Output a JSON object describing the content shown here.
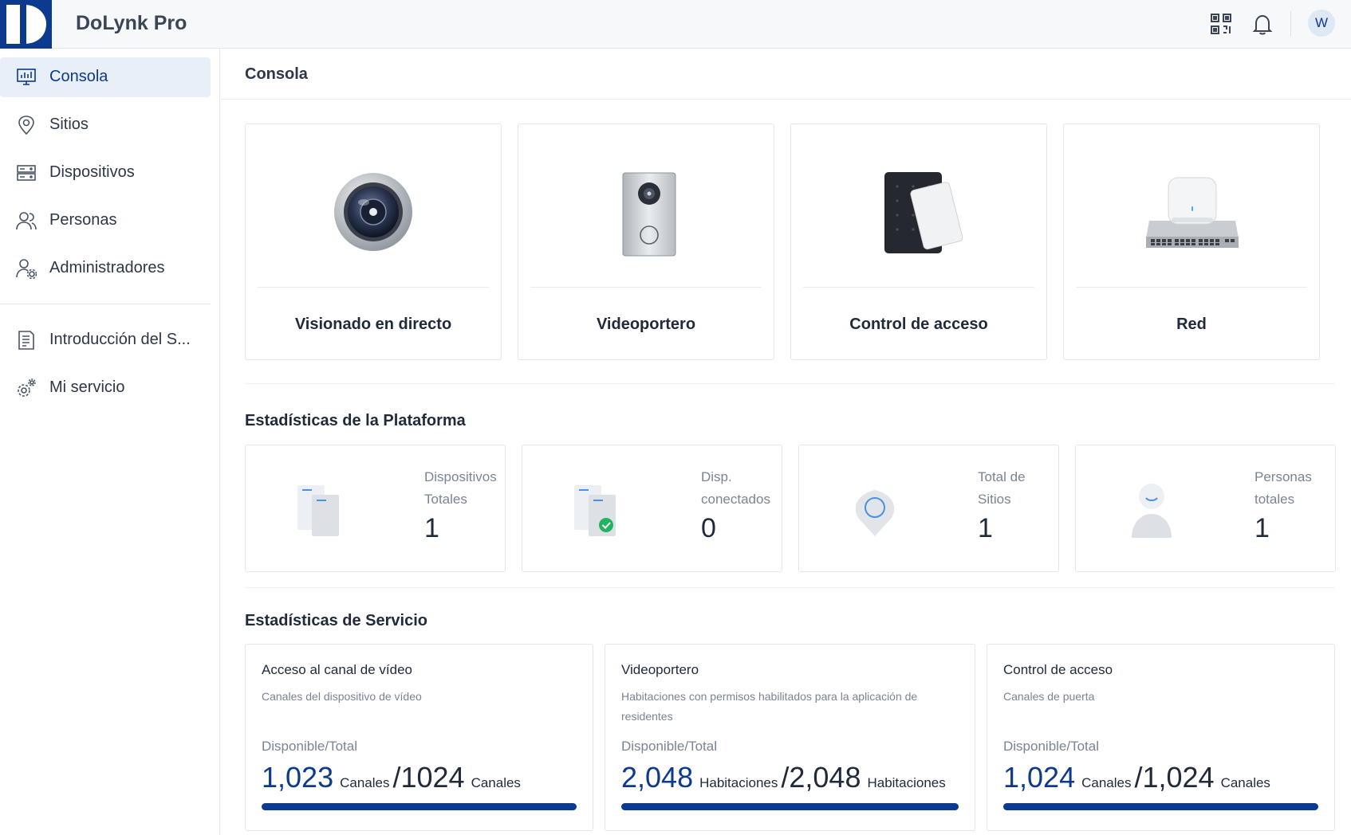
{
  "app": {
    "title": "DoLynk Pro",
    "user_initial": "W"
  },
  "header": {
    "icons": [
      "qr-code-icon",
      "bell-icon"
    ]
  },
  "sidebar": {
    "items": [
      {
        "label": "Consola",
        "icon": "monitor-chart-icon",
        "active": true
      },
      {
        "label": "Sitios",
        "icon": "location-pin-icon"
      },
      {
        "label": "Dispositivos",
        "icon": "server-rack-icon"
      },
      {
        "label": "Personas",
        "icon": "users-icon"
      },
      {
        "label": "Administradores",
        "icon": "user-gear-icon"
      },
      {
        "label": "Introducción del S...",
        "icon": "document-icon"
      },
      {
        "label": "Mi servicio",
        "icon": "gears-icon"
      }
    ]
  },
  "main": {
    "page_title": "Consola",
    "features": [
      {
        "label": "Visionado en directo",
        "icon": "camera-lens-icon"
      },
      {
        "label": "Videoportero",
        "icon": "door-station-icon"
      },
      {
        "label": "Control de acceso",
        "icon": "card-reader-icon"
      },
      {
        "label": "Red",
        "icon": "network-switch-icon"
      }
    ],
    "platform_stats": {
      "title": "Estadísticas de la Plataforma",
      "items": [
        {
          "label": "Dispositivos Totales",
          "value": "1",
          "icon": "devices-icon"
        },
        {
          "label": "Disp. conectados",
          "value": "0",
          "icon": "devices-connected-icon"
        },
        {
          "label": "Total de Sitios",
          "value": "1",
          "icon": "site-pin-icon"
        },
        {
          "label": "Personas totales",
          "value": "1",
          "icon": "person-icon"
        }
      ]
    },
    "service_stats": {
      "title": "Estadísticas de Servicio",
      "items": [
        {
          "title": "Acceso al canal de vídeo",
          "desc": "Canales del dispositivo de vídeo",
          "avail_label": "Disponible/Total",
          "available": "1,023",
          "available_unit": "Canales",
          "total": "/1024",
          "total_unit": "Canales",
          "fill": 0.999
        },
        {
          "title": "Videoportero",
          "desc": "Habitaciones con permisos habilitados para la aplicación de residentes",
          "avail_label": "Disponible/Total",
          "available": "2,048",
          "available_unit": "Habitaciones",
          "total": "/2,048",
          "total_unit": "Habitaciones",
          "fill": 1.0
        },
        {
          "title": "Control de acceso",
          "desc": "Canales de puerta",
          "avail_label": "Disponible/Total",
          "available": "1,024",
          "available_unit": "Canales",
          "total": "/1,024",
          "total_unit": "Canales",
          "fill": 1.0
        }
      ]
    }
  },
  "colors": {
    "brand": "#0b3a8f",
    "active_bg": "#e9eff8",
    "muted_text": "#7a8494"
  }
}
